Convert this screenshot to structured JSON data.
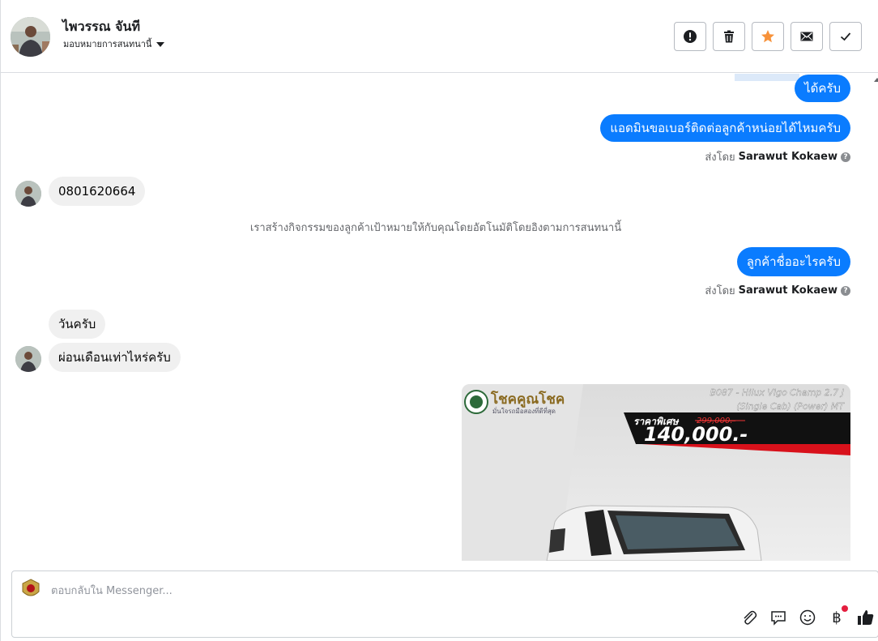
{
  "header": {
    "contact_name": "ไพวรรณ จันที",
    "assign_label": "มอบหมายการสนทนานี้",
    "actions": [
      {
        "name": "report-spam-button",
        "icon": "exclamation-icon"
      },
      {
        "name": "delete-button",
        "icon": "trash-icon"
      },
      {
        "name": "star-button",
        "icon": "star-icon"
      },
      {
        "name": "mark-unread-button",
        "icon": "envelope-icon"
      },
      {
        "name": "mark-done-button",
        "icon": "check-icon"
      }
    ]
  },
  "messages": {
    "out_1": "ได้ครับ",
    "out_2": "แอดมินขอเบอร์ติดต่อลูกค้าหน่อยได้ไหมครับ",
    "sent_by_prefix": "ส่งโดย",
    "sent_by_name": "Sarawut Kokaew",
    "in_1": "0801620664",
    "system_note": "เราสร้างกิจกรรมของลูกค้าเป้าหมายให้กับคุณโดยอัตโนมัติโดยอิงตามการสนทนานี้",
    "out_3": "ลูกค้าชื่ออะไรครับ",
    "in_2": "วันครับ",
    "in_3": "ผ่อนเดือนเท่าไหร่ครับ"
  },
  "ad": {
    "brand": "โชคคูณโชค",
    "brand_sub": "มั่นใจรถมือสองที่ดีที่สุด",
    "model_line1": "B087 - Hilux Vigo Champ 2.7 J",
    "model_line2": "(Single Cab) (Power) MT",
    "promo_label": "ราคาพิเศษ",
    "old_price": "299,000.-",
    "price": "140,000.-"
  },
  "composer": {
    "placeholder": "ตอบกลับใน Messenger...",
    "currency_symbol": "฿"
  },
  "colors": {
    "accent_blue": "#0a7cff",
    "incoming_gray": "#f0f0f0",
    "star_orange": "#f7923a",
    "like_dark": "#1c1e21",
    "badge_red": "#e41e3f"
  }
}
